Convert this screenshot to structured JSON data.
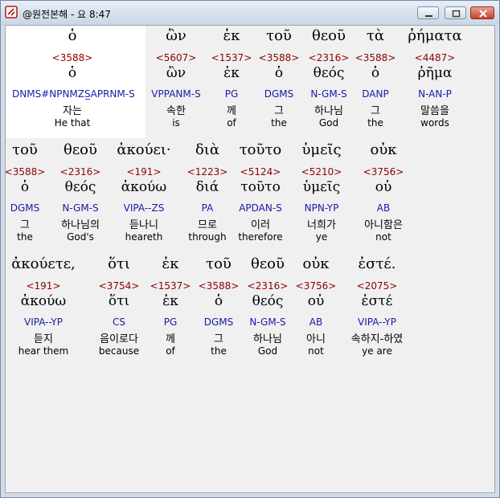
{
  "window": {
    "title": "@원전본해 - 요 8:47"
  },
  "rows": [
    [
      {
        "greek": "ὁ",
        "strong": "<3588>",
        "lemma": "ὁ",
        "parse": "DNMS#NPNMZS̲APRNM-S",
        "korean": "자는",
        "english": "He that"
      },
      {
        "greek": "ὢν",
        "strong": "<5607>",
        "lemma": "ὢν",
        "parse": "VPPANM-S",
        "korean": "속한",
        "english": "is"
      },
      {
        "greek": "ἐκ",
        "strong": "<1537>",
        "lemma": "ἐκ",
        "parse": "PG",
        "korean": "께",
        "english": "of"
      },
      {
        "greek": "τοῦ",
        "strong": "<3588>",
        "lemma": "ὁ",
        "parse": "DGMS",
        "korean": "그",
        "english": "the"
      },
      {
        "greek": "θεοῦ",
        "strong": "<2316>",
        "lemma": "θεός",
        "parse": "N-GM-S",
        "korean": "하나님",
        "english": "God"
      },
      {
        "greek": "τὰ",
        "strong": "<3588>",
        "lemma": "ὁ",
        "parse": "DANP",
        "korean": "그",
        "english": "the"
      },
      {
        "greek": "ῥήματα",
        "strong": "<4487>",
        "lemma": "ῥῆμα",
        "parse": "N-AN-P",
        "korean": "말씀을",
        "english": "words"
      }
    ],
    [
      {
        "greek": "τοῦ",
        "strong": "<3588>",
        "lemma": "ὁ",
        "parse": "DGMS",
        "korean": "그",
        "english": "the"
      },
      {
        "greek": "θεοῦ",
        "strong": "<2316>",
        "lemma": "θεός",
        "parse": "N-GM-S",
        "korean": "하나님의",
        "english": "God's"
      },
      {
        "greek": "ἀκούει·",
        "strong": "<191>",
        "lemma": "ἀκούω",
        "parse": "VIPA--ZS",
        "korean": "듣나니",
        "english": "heareth"
      },
      {
        "greek": "διὰ",
        "strong": "<1223>",
        "lemma": "διά",
        "parse": "PA",
        "korean": "므로",
        "english": "through"
      },
      {
        "greek": "τοῦτο",
        "strong": "<5124>",
        "lemma": "τοῦτο",
        "parse": "APDAN-S",
        "korean": "이러",
        "english": "therefore"
      },
      {
        "greek": "ὑμεῖς",
        "strong": "<5210>",
        "lemma": "ὑμεῖς",
        "parse": "NPN-YP",
        "korean": "너희가",
        "english": "ye"
      },
      {
        "greek": "οὐκ",
        "strong": "<3756>",
        "lemma": "οὐ",
        "parse": "AB",
        "korean": "아니함은",
        "english": "not"
      }
    ],
    [
      {
        "greek": "ἀκούετε,",
        "strong": "<191>",
        "lemma": "ἀκούω",
        "parse": "VIPA--YP",
        "korean": "듣지",
        "english": "hear them"
      },
      {
        "greek": "ὅτι",
        "strong": "<3754>",
        "lemma": "ὅτι",
        "parse": "CS",
        "korean": "음이로다",
        "english": "because"
      },
      {
        "greek": "ἐκ",
        "strong": "<1537>",
        "lemma": "ἐκ",
        "parse": "PG",
        "korean": "께",
        "english": "of"
      },
      {
        "greek": "τοῦ",
        "strong": "<3588>",
        "lemma": "ὁ",
        "parse": "DGMS",
        "korean": "그",
        "english": "the"
      },
      {
        "greek": "θεοῦ",
        "strong": "<2316>",
        "lemma": "θεός",
        "parse": "N-GM-S",
        "korean": "하나님",
        "english": "God"
      },
      {
        "greek": "οὐκ",
        "strong": "<3756>",
        "lemma": "οὐ",
        "parse": "AB",
        "korean": "아니",
        "english": "not"
      },
      {
        "greek": "ἐστέ.",
        "strong": "<2075>",
        "lemma": "ἐστέ",
        "parse": "VIPA--YP",
        "korean": "속하지-하였",
        "english": "ye are"
      }
    ]
  ]
}
